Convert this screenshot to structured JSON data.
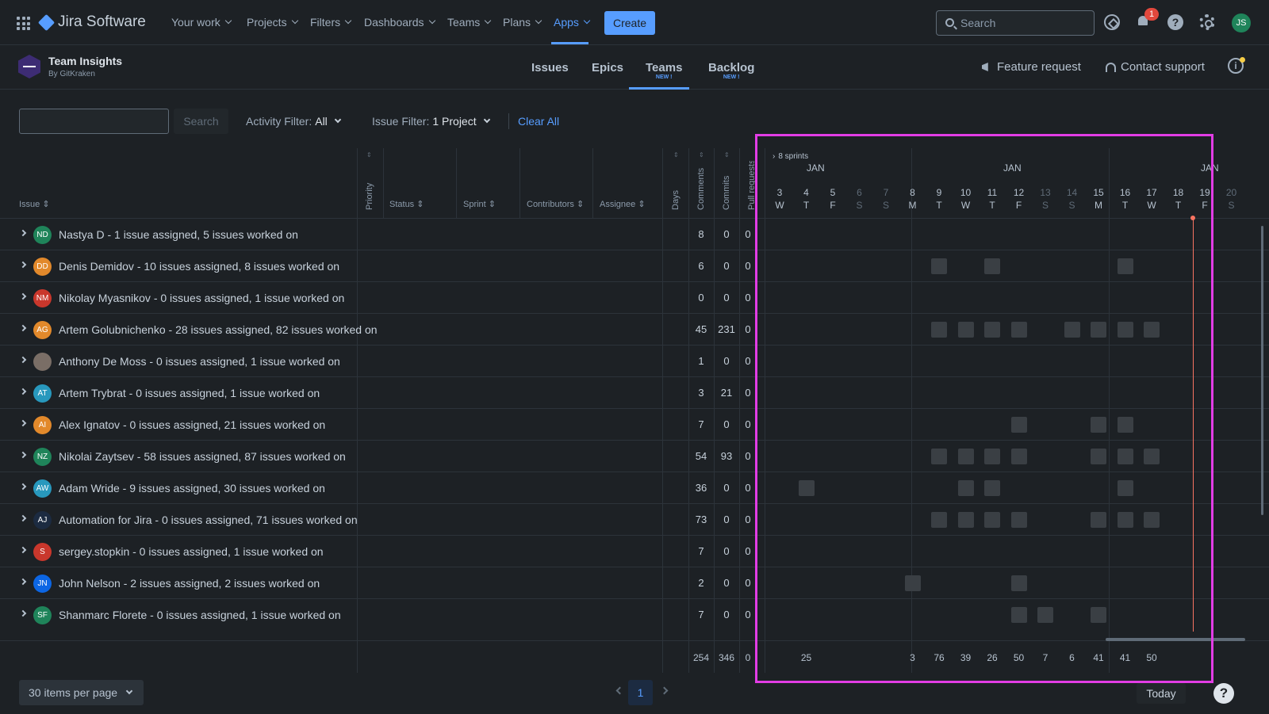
{
  "topnav": {
    "brand": "Jira Software",
    "items": [
      "Your work",
      "Projects",
      "Filters",
      "Dashboards",
      "Teams",
      "Plans",
      "Apps"
    ],
    "create_label": "Create",
    "search_placeholder": "Search",
    "notif_count": "1",
    "help_glyph": "?",
    "user_initials": "JS"
  },
  "app": {
    "title": "Team Insights",
    "subtitle": "By GitKraken",
    "tabs": [
      {
        "label": "Issues",
        "badge": ""
      },
      {
        "label": "Epics",
        "badge": ""
      },
      {
        "label": "Teams",
        "badge": "NEW !"
      },
      {
        "label": "Backlog",
        "badge": "NEW !"
      }
    ],
    "feature_request": "Feature request",
    "contact_support": "Contact support",
    "info_glyph": "i"
  },
  "filters": {
    "search_label": "Search",
    "activity_label": "Activity Filter:",
    "activity_value": "All",
    "issue_label": "Issue Filter:",
    "issue_value": "1 Project",
    "clear_all": "Clear All"
  },
  "table": {
    "headers": {
      "issue": "Issue",
      "priority": "Priority",
      "status": "Status",
      "sprint": "Sprint",
      "contributors": "Contributors",
      "assignee": "Assignee",
      "days": "Days",
      "comments": "Comments",
      "commits": "Commits",
      "pull": "Pull requests"
    },
    "rows": [
      {
        "initials": "ND",
        "color": "#1f845a",
        "name": "Nastya D - 1 issue assigned, 5 issues worked on",
        "comments": "8",
        "commits": "0",
        "pull": "0",
        "activity": []
      },
      {
        "initials": "DD",
        "color": "#e2892b",
        "name": "Denis Demidov - 10 issues assigned, 8 issues worked on",
        "comments": "6",
        "commits": "0",
        "pull": "0",
        "activity": [
          "9",
          "11",
          "16"
        ]
      },
      {
        "initials": "NM",
        "color": "#c9372c",
        "name": "Nikolay Myasnikov - 0 issues assigned, 1 issue worked on",
        "comments": "0",
        "commits": "0",
        "pull": "0",
        "activity": []
      },
      {
        "initials": "AG",
        "color": "#e2892b",
        "name": "Artem Golubnichenko - 28 issues assigned, 82 issues worked on",
        "comments": "45",
        "commits": "231",
        "pull": "0",
        "activity": [
          "9",
          "10",
          "11",
          "12",
          "14",
          "15",
          "16",
          "17"
        ]
      },
      {
        "initials": "",
        "color": "#7a6e66",
        "name": "Anthony De Moss - 0 issues assigned, 1 issue worked on",
        "comments": "1",
        "commits": "0",
        "pull": "0",
        "activity": []
      },
      {
        "initials": "AT",
        "color": "#2898bd",
        "name": "Artem Trybrat - 0 issues assigned, 1 issue worked on",
        "comments": "3",
        "commits": "21",
        "pull": "0",
        "activity": []
      },
      {
        "initials": "AI",
        "color": "#e2892b",
        "name": "Alex Ignatov - 0 issues assigned, 21 issues worked on",
        "comments": "7",
        "commits": "0",
        "pull": "0",
        "activity": [
          "12",
          "15",
          "16"
        ]
      },
      {
        "initials": "NZ",
        "color": "#1f845a",
        "name": "Nikolai Zaytsev - 58 issues assigned, 87 issues worked on",
        "comments": "54",
        "commits": "93",
        "pull": "0",
        "activity": [
          "9",
          "10",
          "11",
          "12",
          "15",
          "16",
          "17"
        ]
      },
      {
        "initials": "AW",
        "color": "#2898bd",
        "name": "Adam Wride - 9 issues assigned, 30 issues worked on",
        "comments": "36",
        "commits": "0",
        "pull": "0",
        "activity": [
          "4",
          "10",
          "11",
          "16"
        ]
      },
      {
        "initials": "AJ",
        "color": "#1c2b41",
        "name": "Automation for Jira - 0 issues assigned, 71 issues worked on",
        "comments": "73",
        "commits": "0",
        "pull": "0",
        "activity": [
          "9",
          "10",
          "11",
          "12",
          "15",
          "16",
          "17"
        ]
      },
      {
        "initials": "S",
        "color": "#c9372c",
        "name": "sergey.stopkin - 0 issues assigned, 1 issue worked on",
        "comments": "7",
        "commits": "0",
        "pull": "0",
        "activity": []
      },
      {
        "initials": "JN",
        "color": "#0c66e4",
        "name": "John Nelson - 2 issues assigned, 2 issues worked on",
        "comments": "2",
        "commits": "0",
        "pull": "0",
        "activity": [
          "8",
          "12"
        ]
      },
      {
        "initials": "SF",
        "color": "#1f845a",
        "name": "Shanmarc Florete - 0 issues assigned, 1 issue worked on",
        "comments": "7",
        "commits": "0",
        "pull": "0",
        "activity": [
          "12",
          "13",
          "15"
        ]
      }
    ],
    "totals": {
      "comments": "254",
      "commits": "346",
      "pull": "0"
    }
  },
  "timeline": {
    "sprints_label": "8 sprints",
    "months": [
      "JAN",
      "JAN",
      "JAN"
    ],
    "days": [
      {
        "n": "3",
        "d": "W",
        "weekend": false
      },
      {
        "n": "4",
        "d": "T",
        "weekend": false
      },
      {
        "n": "5",
        "d": "F",
        "weekend": false
      },
      {
        "n": "6",
        "d": "S",
        "weekend": true
      },
      {
        "n": "7",
        "d": "S",
        "weekend": true
      },
      {
        "n": "8",
        "d": "M",
        "weekend": false
      },
      {
        "n": "9",
        "d": "T",
        "weekend": false
      },
      {
        "n": "10",
        "d": "W",
        "weekend": false
      },
      {
        "n": "11",
        "d": "T",
        "weekend": false
      },
      {
        "n": "12",
        "d": "F",
        "weekend": false
      },
      {
        "n": "13",
        "d": "S",
        "weekend": true
      },
      {
        "n": "14",
        "d": "S",
        "weekend": true
      },
      {
        "n": "15",
        "d": "M",
        "weekend": false
      },
      {
        "n": "16",
        "d": "T",
        "weekend": false
      },
      {
        "n": "17",
        "d": "W",
        "weekend": false
      },
      {
        "n": "18",
        "d": "T",
        "weekend": false
      },
      {
        "n": "19",
        "d": "F",
        "weekend": false
      },
      {
        "n": "20",
        "d": "S",
        "weekend": true
      }
    ],
    "day_totals": [
      {
        "day": "4",
        "value": "25"
      },
      {
        "day": "8",
        "value": "3"
      },
      {
        "day": "9",
        "value": "76"
      },
      {
        "day": "10",
        "value": "39"
      },
      {
        "day": "11",
        "value": "26"
      },
      {
        "day": "12",
        "value": "50"
      },
      {
        "day": "13",
        "value": "7"
      },
      {
        "day": "14",
        "value": "6"
      },
      {
        "day": "15",
        "value": "41"
      },
      {
        "day": "16",
        "value": "41"
      },
      {
        "day": "17",
        "value": "50"
      }
    ],
    "today": "18"
  },
  "footer": {
    "per_page": "30 items per page",
    "current_page": "1",
    "today_button": "Today",
    "help_glyph": "?"
  }
}
